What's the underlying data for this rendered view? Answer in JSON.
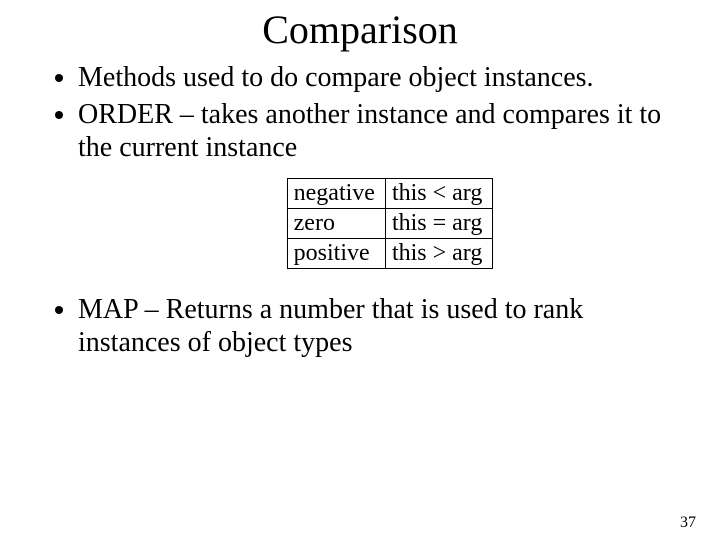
{
  "title": "Comparison",
  "bullets": {
    "b1": "Methods used to do compare object instances.",
    "b2": "ORDER – takes another instance and compares it to the current instance",
    "b3": "MAP – Returns a number that is used to rank instances of object types"
  },
  "table": {
    "rows": [
      {
        "c1": "negative",
        "c2": "this < arg"
      },
      {
        "c1": "zero",
        "c2": "this = arg"
      },
      {
        "c1": "positive",
        "c2": "this > arg"
      }
    ]
  },
  "page_number": "37"
}
